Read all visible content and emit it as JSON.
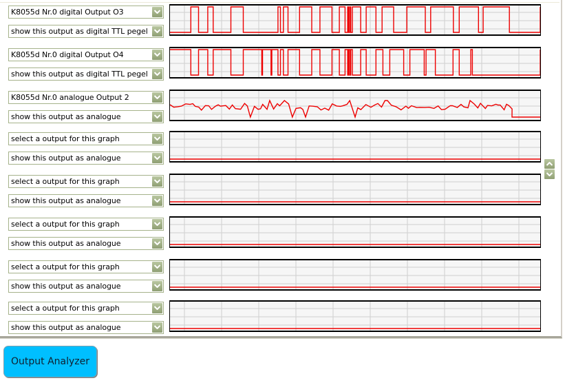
{
  "rows": [
    {
      "output_select": "K8055d Nr.0 digital Output O3",
      "mode_select": "show this output as digital TTL pegel",
      "signal": {
        "type": "digital",
        "transitions": [
          0,
          0.135,
          0.185,
          0.245,
          0.28,
          0.395,
          0.475,
          0.7,
          0.716,
          0.735,
          0.765,
          0.84,
          0.919,
          0.972,
          1.05,
          1.098,
          1.135,
          1.152,
          1.158,
          1.165,
          1.172,
          1.182,
          1.236,
          1.272,
          1.335,
          1.375,
          1.45,
          1.535,
          1.655,
          1.69,
          1.837,
          1.875,
          2.0,
          2.03,
          2.2,
          2.4
        ]
      }
    },
    {
      "output_select": "K8055d Nr.0 digital Output O4",
      "mode_select": "show this output as digital TTL pegel",
      "signal": {
        "type": "digital-inverted",
        "transitions": [
          0,
          0.135,
          0.185,
          0.245,
          0.28,
          0.395,
          0.475,
          0.595,
          0.6,
          0.655,
          0.66,
          0.7,
          0.716,
          0.735,
          0.765,
          0.84,
          0.919,
          0.972,
          1.05,
          1.098,
          1.135,
          1.152,
          1.158,
          1.165,
          1.172,
          1.182,
          1.236,
          1.272,
          1.335,
          1.38,
          1.425,
          1.515,
          1.555,
          1.648,
          1.66,
          1.72,
          1.835,
          1.875,
          1.95,
          1.96,
          2.4
        ]
      }
    },
    {
      "output_select": "K8055d Nr.0 analogue Output 2",
      "mode_select": "show this output as analogue",
      "signal": {
        "type": "analogue"
      }
    },
    {
      "output_select": "select a output for this graph",
      "mode_select": "show this output as analogue",
      "signal": {
        "type": "flat"
      }
    },
    {
      "output_select": "select a output for this graph",
      "mode_select": "show this output as analogue",
      "signal": {
        "type": "flat"
      }
    },
    {
      "output_select": "select a output for this graph",
      "mode_select": "show this output as analogue",
      "signal": {
        "type": "flat"
      }
    },
    {
      "output_select": "select a output for this graph",
      "mode_select": "show this output as analogue",
      "signal": {
        "type": "flat"
      }
    },
    {
      "output_select": "select a output for this graph",
      "mode_select": "show this output as analogue",
      "signal": {
        "type": "flat"
      }
    }
  ],
  "scroll": {
    "up_icon": "arrow-up-icon",
    "down_icon": "arrow-down-icon"
  },
  "analyzer_button": "Output Analyzer",
  "colors": {
    "signal": "#ee0000",
    "grid": "#cfcfcf",
    "combo_border": "#a5b28a",
    "button": "#00bfff"
  }
}
